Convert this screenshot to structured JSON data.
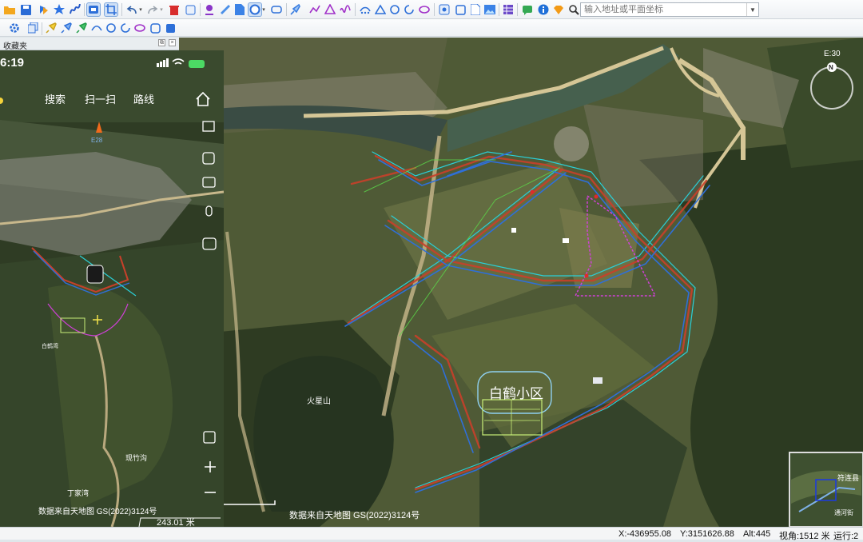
{
  "toolbar": {
    "address_placeholder": "输入地址或平面坐标"
  },
  "favorites_panel": {
    "title": "收藏夹"
  },
  "phone_app": {
    "time": "6:19",
    "nav_items": [
      "搜索",
      "扫一扫",
      "路线"
    ],
    "compass_label": "E28",
    "scale_text": "243.01 米",
    "attribution": "数据来自天地图 GS(2022)3124号",
    "map_labels": [
      "现竹沟",
      "丁家湾",
      "白鹤湾"
    ]
  },
  "main_map": {
    "compass_label": "E:30",
    "compass_n": "N",
    "district_label": "白鹤小区",
    "mountain_label": "火星山",
    "attribution": "数据来自天地图 GS(2022)3124号",
    "overview_label": "符连县",
    "overview_label2": "通河街"
  },
  "status_bar": {
    "x": "X:-436955.08",
    "y": "Y:3151626.88",
    "alt": "Alt:445",
    "view": "视角:1512 米",
    "run": "运行:2"
  },
  "colors": {
    "road_red": "#c8402a",
    "road_blue": "#2f6fd8",
    "road_cyan": "#2ad0d8",
    "boundary_magenta": "#d040d8"
  }
}
